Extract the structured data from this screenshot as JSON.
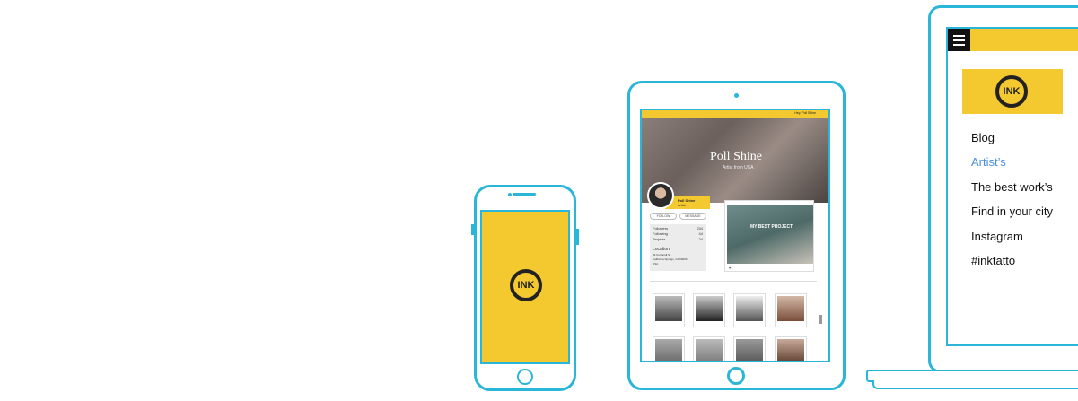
{
  "brand": {
    "logo_text": "INK",
    "accent": "#f4c82f",
    "outline": "#29b6d8"
  },
  "tablet": {
    "topbar_greeting": "Hey, Poll Shine",
    "hero_name": "Poll Shine",
    "hero_subtitle": "Artist from USA",
    "profile_name": "Poll Shine",
    "profile_sub": "artist",
    "follow_label": "FOLLOW",
    "message_label": "MESSAGE",
    "stats": [
      {
        "label": "Followers",
        "value": "234"
      },
      {
        "label": "Following",
        "value": "44"
      },
      {
        "label": "Projects",
        "value": "24"
      }
    ],
    "location_label": "Location",
    "location_lines": [
      "99 Cortlandt St.",
      "California Springs, CA 00006",
      "USA"
    ],
    "best_project_title": "MY BEST PROJECT"
  },
  "laptop": {
    "nav": [
      {
        "label": "Blog",
        "active": false
      },
      {
        "label": "Artist’s",
        "active": true
      },
      {
        "label": "The best work’s",
        "active": false
      },
      {
        "label": "Find in your city",
        "active": false
      },
      {
        "label": "Instagram",
        "active": false
      },
      {
        "label": "#inktatto",
        "active": false
      }
    ]
  }
}
